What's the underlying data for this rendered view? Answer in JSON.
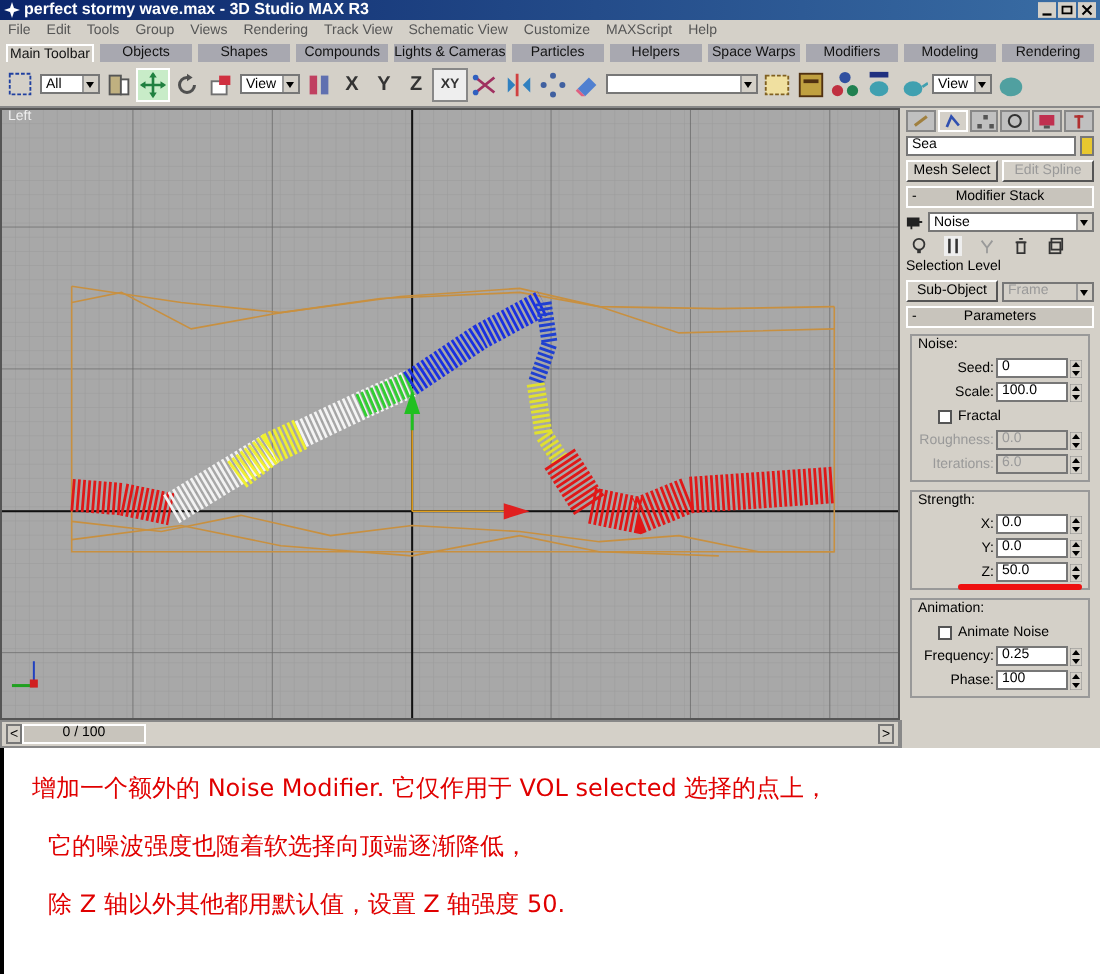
{
  "window": {
    "title": "perfect stormy wave.max - 3D Studio MAX R3"
  },
  "menu": [
    "File",
    "Edit",
    "Tools",
    "Group",
    "Views",
    "Rendering",
    "Track View",
    "Schematic View",
    "Customize",
    "MAXScript",
    "Help"
  ],
  "tabs": [
    {
      "label": "Main Toolbar",
      "selected": true
    },
    {
      "label": "Objects",
      "selected": false
    },
    {
      "label": "Shapes",
      "selected": false
    },
    {
      "label": "Compounds",
      "selected": false
    },
    {
      "label": "Lights & Cameras",
      "selected": false
    },
    {
      "label": "Particles",
      "selected": false
    },
    {
      "label": "Helpers",
      "selected": false
    },
    {
      "label": "Space Warps",
      "selected": false
    },
    {
      "label": "Modifiers",
      "selected": false
    },
    {
      "label": "Modeling",
      "selected": false
    },
    {
      "label": "Rendering",
      "selected": false
    }
  ],
  "toolbar": {
    "selection_filter": "All",
    "reference_coord": "View",
    "render_type": "View",
    "tools": [
      {
        "kind": "move",
        "selected": true
      },
      {
        "kind": "rotate",
        "selected": false
      },
      {
        "kind": "scale",
        "selected": false
      }
    ],
    "axes": [
      {
        "label": "X",
        "selected": false
      },
      {
        "label": "Y",
        "selected": false
      },
      {
        "label": "Z",
        "selected": false
      },
      {
        "label": "XY",
        "selected": true
      }
    ]
  },
  "viewport": {
    "label": "Left"
  },
  "command_panel": {
    "tabs": [
      {
        "kind": "create",
        "selected": false
      },
      {
        "kind": "modify",
        "selected": true
      },
      {
        "kind": "hierarchy",
        "selected": false
      },
      {
        "kind": "motion",
        "selected": false
      },
      {
        "kind": "display",
        "selected": false
      },
      {
        "kind": "utilities",
        "selected": false
      }
    ],
    "object_name": "Sea",
    "buttons": [
      {
        "label": "Mesh Select",
        "disabled": false
      },
      {
        "label": "Edit Spline",
        "disabled": true
      }
    ],
    "modifier_stack": {
      "title": "Modifier Stack",
      "collapse": "-",
      "current": "Noise"
    },
    "selection_level": {
      "label": "Selection Level",
      "button": "Sub-Object",
      "dropdown": "Frame",
      "dropdown_disabled": true
    },
    "parameters": {
      "title": "Parameters",
      "collapse": "-",
      "groups": [
        {
          "title": "Noise:",
          "rows": [
            {
              "kind": "spinner",
              "label": "Seed:",
              "value": "0",
              "disabled": false,
              "highlighted": false
            },
            {
              "kind": "spinner",
              "label": "Scale:",
              "value": "100.0",
              "disabled": false,
              "highlighted": false
            },
            {
              "kind": "checkbox",
              "label": "Fractal",
              "checked": false,
              "disabled": false
            },
            {
              "kind": "spinner",
              "label": "Roughness:",
              "value": "0.0",
              "disabled": true,
              "highlighted": false
            },
            {
              "kind": "spinner",
              "label": "Iterations:",
              "value": "6.0",
              "disabled": true,
              "highlighted": false
            }
          ]
        },
        {
          "title": "Strength:",
          "rows": [
            {
              "kind": "spinner",
              "label": "X:",
              "value": "0.0",
              "disabled": false,
              "highlighted": false
            },
            {
              "kind": "spinner",
              "label": "Y:",
              "value": "0.0",
              "disabled": false,
              "highlighted": false
            },
            {
              "kind": "spinner",
              "label": "Z:",
              "value": "50.0",
              "disabled": false,
              "highlighted": true
            }
          ]
        },
        {
          "title": "Animation:",
          "rows": [
            {
              "kind": "checkbox",
              "label": "Animate Noise",
              "checked": false,
              "disabled": false
            },
            {
              "kind": "spinner",
              "label": "Frequency:",
              "value": "0.25",
              "disabled": false,
              "highlighted": false
            },
            {
              "kind": "spinner",
              "label": "Phase:",
              "value": "100",
              "disabled": false,
              "highlighted": false
            }
          ]
        }
      ]
    }
  },
  "time_slider": {
    "label": "0 / 100",
    "prev": "<",
    "next": ">"
  },
  "caption": {
    "lines": [
      "增加一个额外的 Noise Modifier. 它仅作用于 VOL selected 选择的点上，",
      "它的噪波强度也随着软选择向顶端逐渐降低，",
      "除 Z 轴以外其他都用默认值，设置 Z 轴强度 50."
    ]
  }
}
